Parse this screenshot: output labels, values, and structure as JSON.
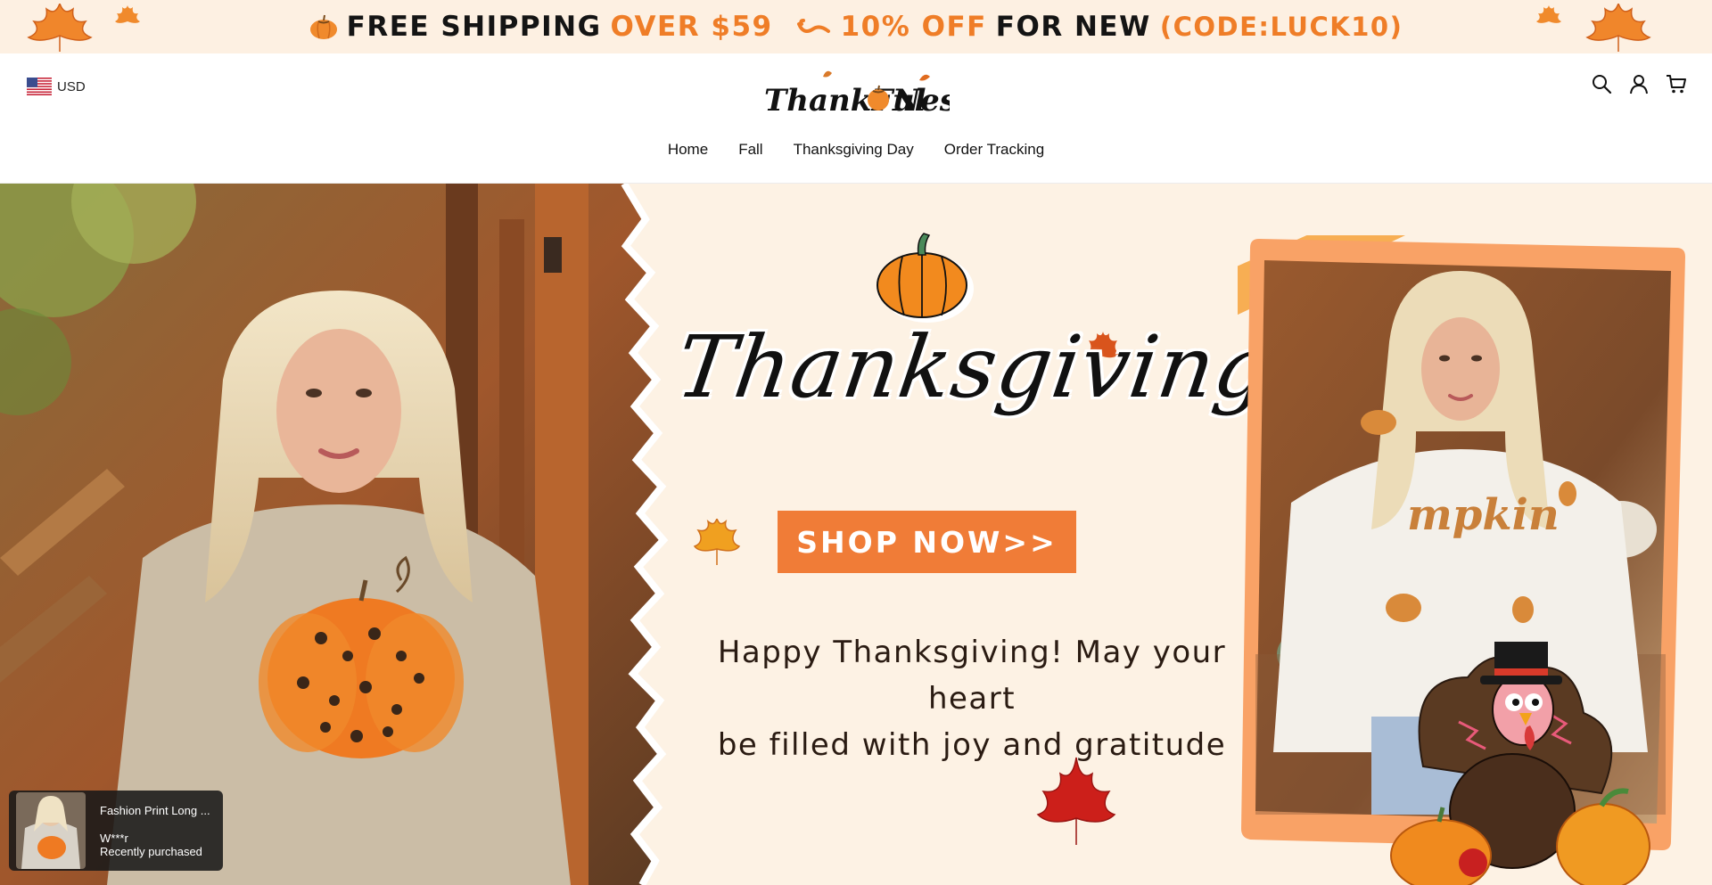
{
  "announcement": {
    "part1": "FREE SHIPPING",
    "part2": "OVER $59",
    "part3": "10% OFF",
    "part4": "FOR NEW",
    "part5": "(CODE:LUCK10)"
  },
  "header": {
    "currency": "USD",
    "logo_text": "ThankFul Nest",
    "icons": [
      "search-icon",
      "account-icon",
      "cart-icon"
    ]
  },
  "nav": {
    "items": [
      "Home",
      "Fall",
      "Thanksgiving Day",
      "Order Tracking"
    ]
  },
  "hero": {
    "title": "Thanksgiving Day",
    "button": "SHOP NOW>>",
    "message_line1": "Happy Thanksgiving! May your heart",
    "message_line2": "be filled with joy and gratitude",
    "sweater_text": "mpkin"
  },
  "toast": {
    "title": "Fashion Print Long ...",
    "user": "W***r",
    "status": "Recently purchased"
  },
  "colors": {
    "accent": "#ef7d27",
    "button": "#f07c37",
    "announce_bg": "#fdf0e2",
    "hero_bg": "#fdf2e4"
  }
}
